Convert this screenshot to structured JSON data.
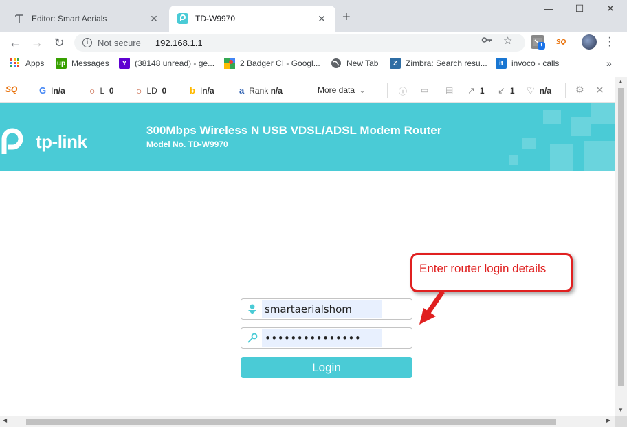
{
  "tabs": [
    {
      "title": "Editor: Smart Aerials",
      "icon": "wordpress-t-icon"
    },
    {
      "title": "TD-W9970",
      "icon": "tplink-icon"
    }
  ],
  "window": {
    "minimize": "—",
    "maximize": "☐",
    "close": "✕"
  },
  "toolbar": {
    "security_label": "Not secure",
    "url": "192.168.1.1"
  },
  "bookmarks": [
    {
      "label": "Apps",
      "icon": "apps-grid-icon"
    },
    {
      "label": "Messages",
      "icon": "upwork-icon",
      "icon_text": "up"
    },
    {
      "label": "(38148 unread) - ge...",
      "icon": "yahoo-icon",
      "icon_text": "Y"
    },
    {
      "label": "2 Badger CI - Googl...",
      "icon": "google-maps-icon"
    },
    {
      "label": "New Tab",
      "icon": "globe-icon"
    },
    {
      "label": "Zimbra: Search resu...",
      "icon": "zimbra-icon",
      "icon_text": "Z"
    },
    {
      "label": "invoco - calls",
      "icon": "invoco-icon",
      "icon_text": "it"
    }
  ],
  "seobar": {
    "google_label": "I",
    "google_value": "n/a",
    "l_label": "L",
    "l_value": "0",
    "ld_label": "LD",
    "ld_value": "0",
    "bing_label": "I",
    "bing_value": "n/a",
    "rank_label": "Rank",
    "rank_value": "n/a",
    "more_data": "More data",
    "ext_links": "1",
    "int_links": "1",
    "heart_value": "n/a"
  },
  "router": {
    "logo_text": "tp-link",
    "title": "300Mbps Wireless N USB VDSL/ADSL Modem Router",
    "model": "Model No. TD-W9970"
  },
  "login": {
    "username": "smartaerialshom",
    "password": "•••••••••••••••",
    "button": "Login"
  },
  "callout": {
    "text": "Enter router login details"
  },
  "colors": {
    "brand": "#4acbd6",
    "callout": "#e02020",
    "autofill": "#e8f0fe"
  }
}
